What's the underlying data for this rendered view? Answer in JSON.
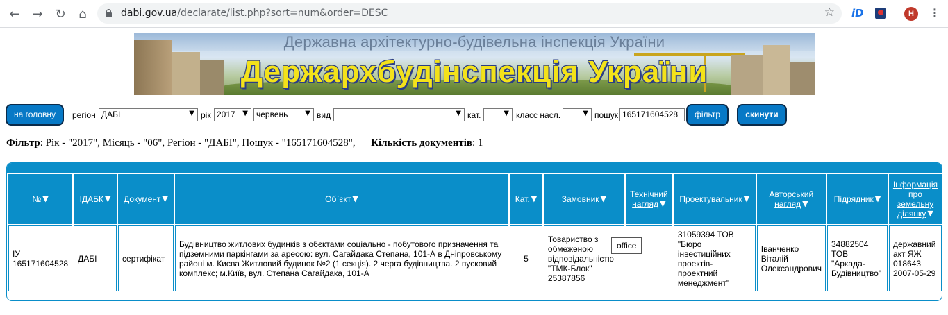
{
  "browser": {
    "url_host": "dabi.gov.ua",
    "url_path": "/declarate/list.php?sort=num&order=DESC",
    "extension_id_label": "iD",
    "avatar_initial": "H"
  },
  "banner": {
    "subtitle": "Державна архітектурно-будівельна інспекція України",
    "title": "Держархбудінспекція України"
  },
  "filters": {
    "home_button": "на головну",
    "region_label": "регіон",
    "region_value": "ДАБІ",
    "year_label": "рік",
    "year_value": "2017",
    "month_value": "червень",
    "type_label": "вид",
    "type_value": "",
    "cat_label": "кат.",
    "cat_value": "",
    "class_label": "класс насл.",
    "class_value": "",
    "search_label": "пошук",
    "search_value": "165171604528",
    "filter_button": "фільтр",
    "reset_button": "скинути"
  },
  "summary": {
    "filter_label": "Фільтр",
    "filter_text": ": Рік - \"2017\", Місяць - \"06\", Регіон - \"ДАБІ\", Пошук - \"165171604528\",",
    "count_label": "Кількість документів",
    "count_value": ": 1"
  },
  "table": {
    "columns": [
      {
        "label": "№",
        "arrow": "▼"
      },
      {
        "label": "ІДАБК",
        "arrow": "▼"
      },
      {
        "label": "Документ",
        "arrow": "▼"
      },
      {
        "label": "Об`єкт",
        "arrow": "▼"
      },
      {
        "label": "Кат.",
        "arrow": "▼"
      },
      {
        "label": "Замовник",
        "arrow": "▼"
      },
      {
        "label": "Технічний нагляд",
        "arrow": "▼"
      },
      {
        "label": "Проектувальник",
        "arrow": "▼"
      },
      {
        "label": "Авторський нагляд",
        "arrow": "▼"
      },
      {
        "label": "Підрядник",
        "arrow": "▼"
      },
      {
        "label": "Інформація про земельну ділянку",
        "arrow": "▼"
      }
    ],
    "rows": [
      {
        "num": "ІУ 165171604528",
        "idabk": "ДАБІ",
        "doc": "сертифікат",
        "object": "Будівництво житлових будинків з обєктами соціально - побутового призначення та підземними паркінгами за аресою: вул. Сагайдака Степана, 101-А в Дніпровському районі м. Києва Житловий будинок №2 (1 секція). 2 черга будівництва. 2 пусковий комплекс; м.Київ, вул. Степана Сагайдака, 101-А",
        "cat": "5",
        "customer": "Товариство з обмеженою відповідальністю \"ТМК-Блок\" 25387856",
        "tech": "",
        "designer": "31059394 ТОВ \"Бюро інвестиційних проектів-проектний менеджмент\"",
        "author": "Іванченко Віталій Олександрович",
        "contractor": "34882504 ТОВ \"Аркада-Будівництво\"",
        "land": "державний акт ЯЖ 018643 2007-05-29"
      }
    ]
  },
  "tooltip": "office"
}
